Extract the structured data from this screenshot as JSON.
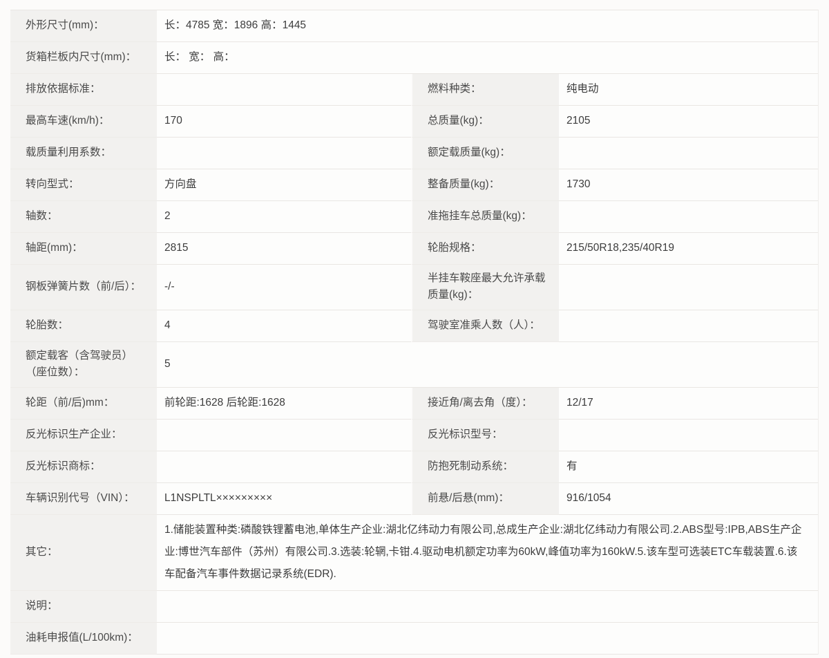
{
  "theme": {
    "page_bg": "#fcfbfa",
    "label_bg": "#f2f1ef",
    "value_bg": "#fdfdfc",
    "border": "#e9e6e3",
    "label_text": "#4a4a4a",
    "value_text": "#3c3c3c"
  },
  "table": {
    "rows": [
      {
        "type": "full",
        "left_label": "外形尺寸(mm)：",
        "value": "长：4785 宽：1896 高：1445"
      },
      {
        "type": "full",
        "left_label": "货箱栏板内尺寸(mm)：",
        "value": "长： 宽： 高："
      },
      {
        "type": "split",
        "left_label": "排放依据标准：",
        "left_value": "",
        "right_label": "燃料种类：",
        "right_value": "纯电动"
      },
      {
        "type": "split",
        "left_label": "最高车速(km/h)：",
        "left_value": "170",
        "right_label": "总质量(kg)：",
        "right_value": "2105"
      },
      {
        "type": "split",
        "left_label": "载质量利用系数：",
        "left_value": "",
        "right_label": "额定载质量(kg)：",
        "right_value": ""
      },
      {
        "type": "split",
        "left_label": "转向型式：",
        "left_value": "方向盘",
        "right_label": "整备质量(kg)：",
        "right_value": "1730"
      },
      {
        "type": "split",
        "left_label": "轴数：",
        "left_value": "2",
        "right_label": "准拖挂车总质量(kg)：",
        "right_value": ""
      },
      {
        "type": "split",
        "left_label": "轴距(mm)：",
        "left_value": "2815",
        "right_label": "轮胎规格：",
        "right_value": "215/50R18,235/40R19"
      },
      {
        "type": "split",
        "left_label": "钢板弹簧片数（前/后）：",
        "left_value": "-/-",
        "right_label": "半挂车鞍座最大允许承载\n质量(kg)：",
        "right_value": ""
      },
      {
        "type": "split",
        "left_label": "轮胎数：",
        "left_value": "4",
        "right_label": "驾驶室准乘人数（人）：",
        "right_value": ""
      },
      {
        "type": "full",
        "left_label": "额定载客（含驾驶员）\n（座位数）：",
        "value": "5"
      },
      {
        "type": "split",
        "left_label": "轮距（前/后)mm：",
        "left_value": "前轮距:1628 后轮距:1628",
        "right_label": "接近角/离去角（度）：",
        "right_value": "12/17"
      },
      {
        "type": "split",
        "left_label": "反光标识生产企业：",
        "left_value": "",
        "right_label": "反光标识型号：",
        "right_value": ""
      },
      {
        "type": "split",
        "left_label": "反光标识商标：",
        "left_value": "",
        "right_label": "防抱死制动系统：",
        "right_value": "有"
      },
      {
        "type": "split",
        "left_label": "车辆识别代号（VIN）：",
        "left_value": "L1NSPLTL×××××××××",
        "right_label": "前悬/后悬(mm)：",
        "right_value": "916/1054"
      },
      {
        "type": "full",
        "left_label": "其它：",
        "value": "1.储能装置种类:磷酸铁锂蓄电池,单体生产企业:湖北亿纬动力有限公司,总成生产企业:湖北亿纬动力有限公司.2.ABS型号:IPB,ABS生产企业:博世汽车部件（苏州）有限公司.3.选装:轮辋,卡钳.4.驱动电机额定功率为60kW,峰值功率为160kW.5.该车型可选装ETC车载装置.6.该车配备汽车事件数据记录系统(EDR)."
      },
      {
        "type": "full",
        "left_label": "说明：",
        "value": ""
      },
      {
        "type": "full",
        "left_label": "油耗申报值(L/100km)：",
        "value": ""
      }
    ]
  }
}
